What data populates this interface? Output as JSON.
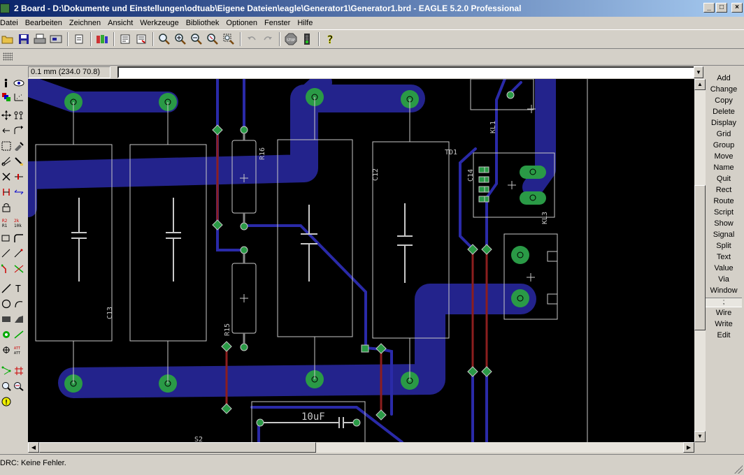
{
  "window": {
    "title": "2 Board - D:\\Dokumente und Einstellungen\\odtuab\\Eigene Dateien\\eagle\\Generator1\\Generator1.brd - EAGLE 5.2.0 Professional",
    "minimize": "_",
    "maximize": "□",
    "close": "×"
  },
  "menu": [
    "Datei",
    "Bearbeiten",
    "Zeichnen",
    "Ansicht",
    "Werkzeuge",
    "Bibliothek",
    "Optionen",
    "Fenster",
    "Hilfe"
  ],
  "command_row": {
    "coordinates": "0.1 mm (234.0 70.8)",
    "command_value": ""
  },
  "commands": [
    "Add",
    "Change",
    "Copy",
    "Delete",
    "Display",
    "Grid",
    "Group",
    "Move",
    "Name",
    "Quit",
    "Rect",
    "Route",
    "Script",
    "Show",
    "Signal",
    "Split",
    "Text",
    "Value",
    "Via",
    "Window"
  ],
  "command_separator": ";",
  "commands_extra": [
    "Wire",
    "Write",
    "Edit"
  ],
  "status": "DRC: Keine Fehler.",
  "board_labels": {
    "C13": "C13",
    "R16": "R16",
    "R15": "R15",
    "C12": "C12",
    "TD1": "TD1",
    "KL1": "KL1",
    "KL3": "KL3",
    "C14": "C14",
    "S2": "S2",
    "cap_value": "10uF"
  },
  "colors": {
    "board_bg": "#000000",
    "bottom_copper": "#23238c",
    "top_copper": "#8c1e1e",
    "pad": "#2a9a46",
    "outline": "#c8c8c8",
    "title_bar": "#0a246a"
  }
}
